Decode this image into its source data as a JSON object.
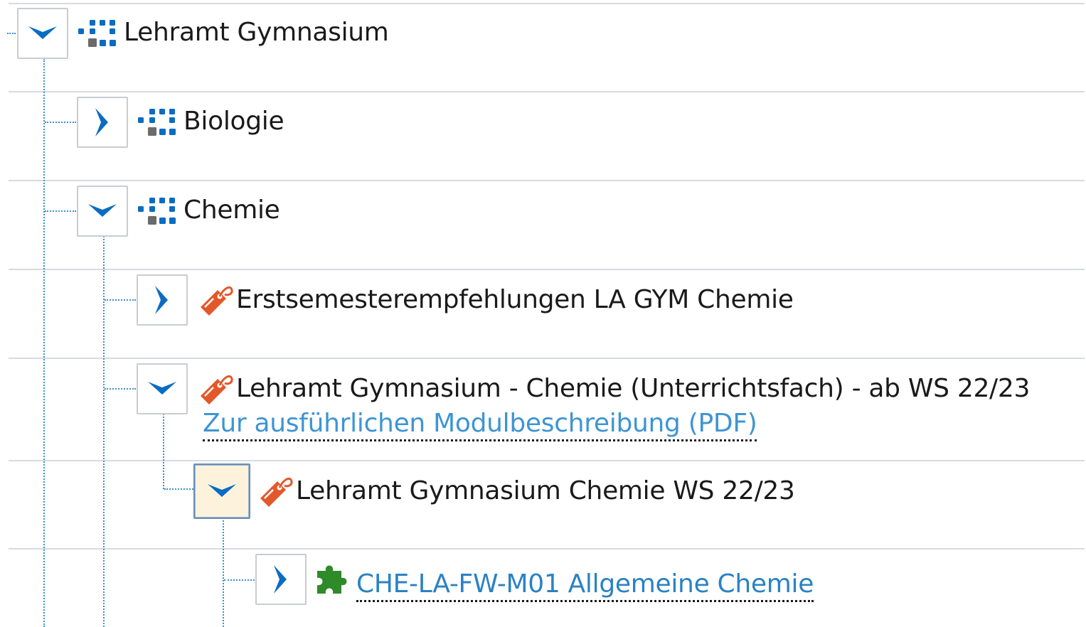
{
  "tree": {
    "nodes": [
      {
        "label": "Lehramt Gymnasium",
        "state": "expanded",
        "icon": "structure-icon"
      },
      {
        "label": "Biologie",
        "state": "collapsed",
        "icon": "structure-icon"
      },
      {
        "label": "Chemie",
        "state": "expanded",
        "icon": "structure-icon"
      },
      {
        "label": "Erstsemesterempfehlungen LA GYM Chemie",
        "state": "collapsed",
        "icon": "tag-icon"
      },
      {
        "label": "Lehramt Gymnasium - Chemie (Unterrichtsfach) - ab WS 22/23",
        "state": "expanded",
        "icon": "tag-icon",
        "link": "Zur ausführlichen Modulbeschreibung (PDF)"
      },
      {
        "label": "Lehramt Gymnasium Chemie WS 22/23",
        "state": "expanded",
        "icon": "tag-icon",
        "selected": true
      },
      {
        "label": "CHE-LA-FW-M01 Allgemeine Chemie",
        "state": "collapsed",
        "icon": "puzzle-icon",
        "is_link": true
      }
    ]
  },
  "colors": {
    "accent_blue": "#0a6cc2",
    "link_blue": "#3d95d3",
    "tag_orange": "#e2582a",
    "puzzle_green": "#2f8a2a",
    "structure_gray": "#6b6b6b",
    "selected_bg": "#fdf2dc"
  }
}
